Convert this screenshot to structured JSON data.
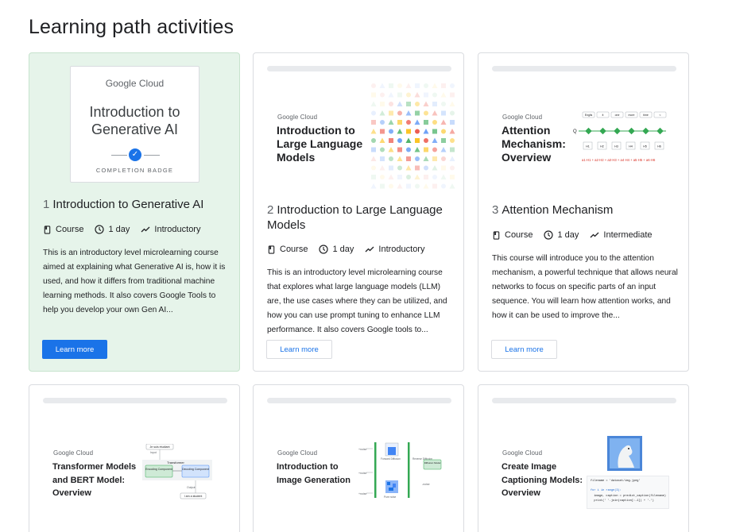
{
  "page": {
    "title": "Learning path activities"
  },
  "icons": {
    "course": "book-icon",
    "duration": "clock-icon",
    "level": "trending-icon",
    "completed": "check-circle-icon"
  },
  "colors": {
    "accent": "#1a73e8",
    "active_card_bg": "#e6f4ea"
  },
  "cards": [
    {
      "number": "1",
      "title": "Introduction to Generative AI",
      "type": "Course",
      "duration": "1 day",
      "level": "Introductory",
      "description": "This is an introductory level microlearning course aimed at explaining what Generative AI is, how it is used, and how it differs from traditional machine learning methods. It also covers Google Tools to help you develop your own Gen AI...",
      "button": "Learn more",
      "badge": {
        "logo": "Google Cloud",
        "title": "Introduction to Generative AI",
        "subtitle": "COMPLETION BADGE"
      }
    },
    {
      "number": "2",
      "title": "Introduction to Large Language Models",
      "type": "Course",
      "duration": "1 day",
      "level": "Introductory",
      "description": "This is an introductory level microlearning course that explores what large language models (LLM) are, the use cases where they can be utilized, and how you can use prompt tuning to enhance LLM performance. It also covers Google tools to...",
      "button": "Learn more",
      "thumb": {
        "logo": "Google Cloud",
        "title": "Introduction to Large Language Models"
      }
    },
    {
      "number": "3",
      "title": "Attention Mechanism",
      "type": "Course",
      "duration": "1 day",
      "level": "Intermediate",
      "description": "This course will introduce you to the attention mechanism, a powerful technique that allows neural networks to focus on specific parts of an input sequence. You will learn how attention works, and how it can be used to improve the...",
      "button": "Learn more",
      "thumb": {
        "logo": "Google Cloud",
        "title": "Attention Mechanism: Overview",
        "diagram": {
          "tokens": [
            "Englis",
            "it",
            "one",
            "more",
            "time",
            "<"
          ],
          "hidden_labels": [
            "H1",
            "H2",
            "H3",
            "H4",
            "H5",
            "H6"
          ],
          "formula": "a1·H1 + a2·H2 + a3·H3 + a4·H4 + a5·H5 + a6·H6"
        }
      }
    },
    {
      "thumb": {
        "logo": "Google Cloud",
        "title": "Transformer Models and BERT Model: Overview",
        "diagram": {
          "input": "Je suis étudiant",
          "input_label": "Input",
          "block": "Transformer",
          "encoder": "Encoding Component",
          "decoder": "Decoding Component",
          "output_label": "Output",
          "output": "I am a student"
        }
      }
    },
    {
      "thumb": {
        "logo": "Google Cloud",
        "title": "Introduction to Image Generation",
        "diagram": {
          "model": "Diffusion Model",
          "forward": "Forward Diffusion",
          "reverse": "Reverse Diffusion",
          "noise": "Pure noise",
          "noise_tag": "+noise",
          "denoise_tag": "-noise"
        }
      }
    },
    {
      "thumb": {
        "logo": "Google Cloud",
        "title": "Create Image Captioning Models: Overview",
        "code": [
          "filename = 'dataset/img.jpeg'",
          "",
          "for i in range(3):",
          "  image, caption = predict_caption(filename)",
          "  print(' '.join(caption[:-1]) + '.')"
        ]
      }
    }
  ]
}
